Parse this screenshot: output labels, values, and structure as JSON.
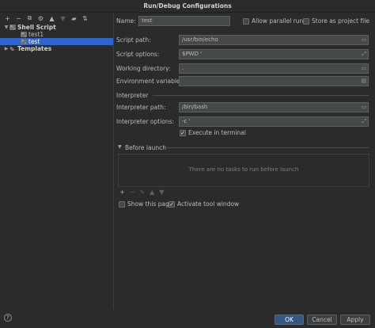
{
  "window": {
    "title": "Run/Debug Configurations"
  },
  "toolbar": {
    "icons": [
      "add-icon",
      "remove-icon",
      "copy-icon",
      "wrench-icon",
      "move-up-icon",
      "move-down-icon",
      "folder-icon",
      "sort-icon"
    ]
  },
  "tree": {
    "group_label": "Shell Script",
    "items": [
      {
        "label": "test1"
      },
      {
        "label": "test"
      }
    ],
    "templates_label": "Templates"
  },
  "form": {
    "name_label": "Name:",
    "name_value": "test",
    "allow_parallel_label": "Allow parallel run",
    "store_project_label": "Store as project file",
    "script_path_label": "Script path:",
    "script_path_value": "/usr/bin/echo",
    "script_options_label": "Script options:",
    "script_options_value": "$PWD '",
    "working_dir_label": "Working directory:",
    "working_dir_value": ".",
    "env_vars_label": "Environment variables:",
    "env_vars_value": "",
    "interpreter_section": "Interpreter",
    "interp_path_label": "Interpreter path:",
    "interp_path_value": "/bin/bash",
    "interp_options_label": "Interpreter options:",
    "interp_options_value": "-c '",
    "execute_terminal_label": "Execute in terminal",
    "execute_terminal_checked": true
  },
  "before_launch": {
    "title": "Before launch",
    "empty_text": "There are no tasks to run before launch",
    "show_page_label": "Show this page",
    "show_page_checked": false,
    "activate_tool_label": "Activate tool window",
    "activate_tool_checked": true
  },
  "buttons": {
    "help": "?",
    "ok": "OK",
    "cancel": "Cancel",
    "apply": "Apply"
  },
  "colors": {
    "background": "#2b2b2b",
    "selection": "#2f65ca",
    "primary_button": "#365880"
  }
}
